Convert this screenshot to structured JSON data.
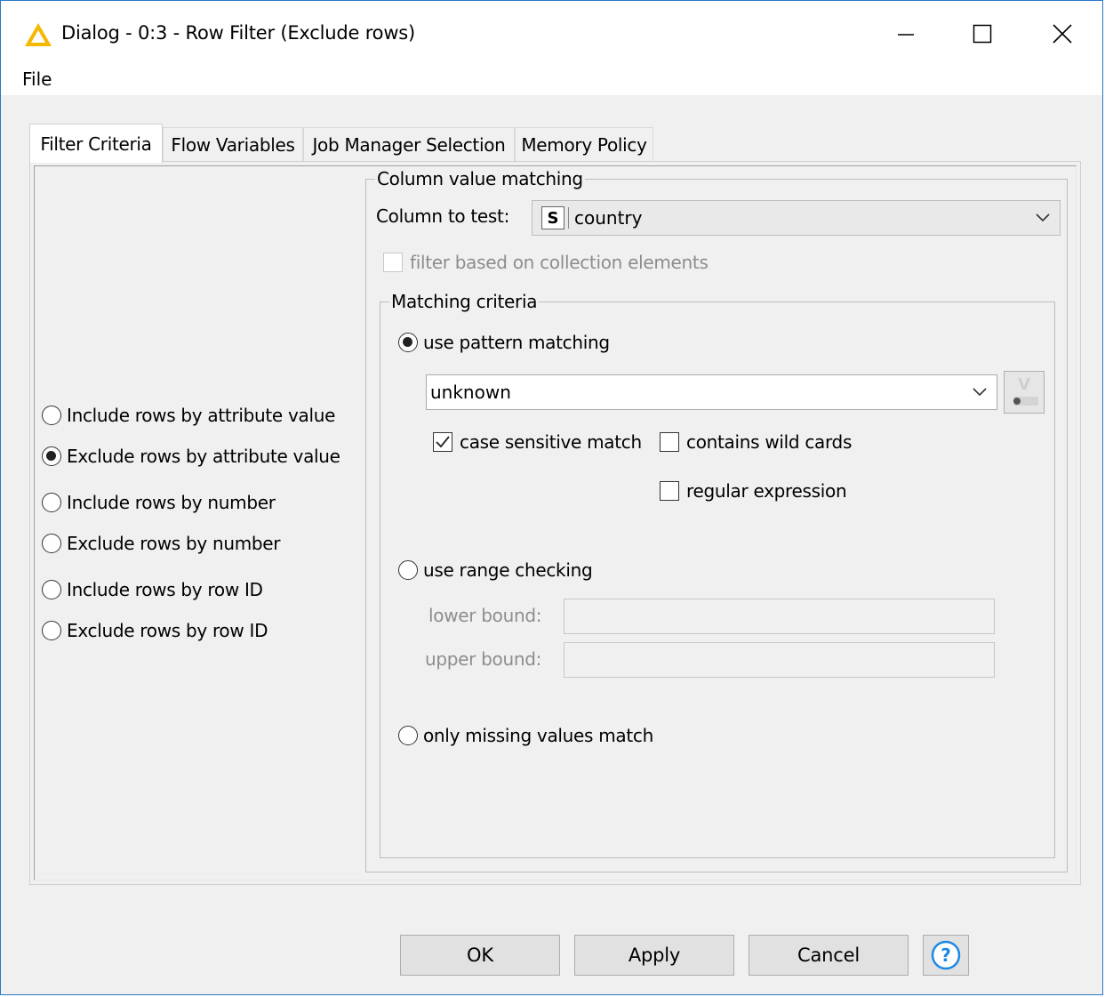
{
  "window": {
    "title": "Dialog - 0:3 - Row Filter (Exclude rows)",
    "app_icon": "knime-warning-triangle-icon",
    "controls": [
      "minimize-icon",
      "maximize-icon",
      "close-icon"
    ]
  },
  "menu": {
    "file": "File"
  },
  "tabs": [
    {
      "label": "Filter Criteria",
      "active": true
    },
    {
      "label": "Flow Variables",
      "active": false
    },
    {
      "label": "Job Manager Selection",
      "active": false
    },
    {
      "label": "Memory Policy",
      "active": false
    }
  ],
  "filter_mode": {
    "options": [
      {
        "label": "Include rows by attribute value",
        "checked": false
      },
      {
        "label": "Exclude rows by attribute value",
        "checked": true
      },
      {
        "label": "Include rows by number",
        "checked": false
      },
      {
        "label": "Exclude rows by number",
        "checked": false
      },
      {
        "label": "Include rows by row ID",
        "checked": false
      },
      {
        "label": "Exclude rows by row ID",
        "checked": false
      }
    ]
  },
  "column_matching": {
    "legend": "Column value matching",
    "column_label": "Column to test:",
    "column_type": "S",
    "column_value": "country",
    "collection_checkbox": "filter based on collection elements"
  },
  "matching_criteria": {
    "legend": "Matching criteria",
    "pattern_option": "use pattern matching",
    "pattern_value": "unknown",
    "case_sensitive": "case sensitive match",
    "wild_cards": "contains wild cards",
    "regex": "regular expression",
    "range_option": "use range checking",
    "lower_bound": "lower bound:",
    "upper_bound": "upper bound:",
    "missing_option": "only missing values match"
  },
  "buttons": {
    "ok": "OK",
    "apply": "Apply",
    "cancel": "Cancel"
  },
  "colors": {
    "accent": "#2b78c5",
    "help": "#1e88e5",
    "icon_yellow": "#f5b800"
  }
}
